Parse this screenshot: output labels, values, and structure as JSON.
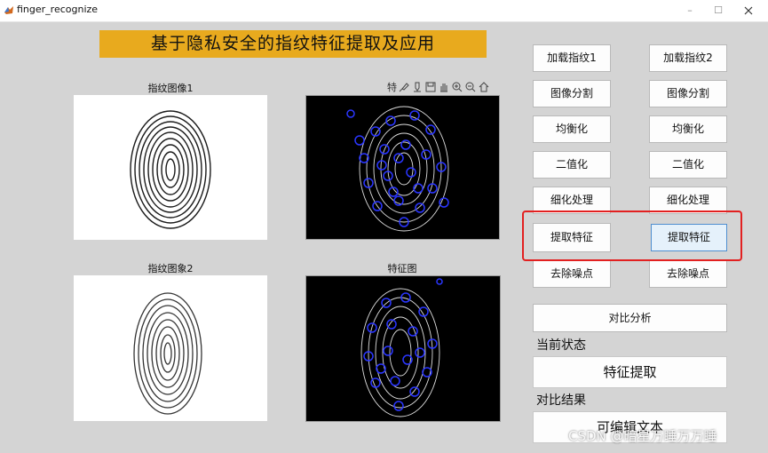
{
  "window": {
    "title": "finger_recognize",
    "minimize": "–",
    "maximize": "☐"
  },
  "banner": {
    "title": "基于隐私安全的指纹特征提取及应用"
  },
  "axes": {
    "img1_title": "指纹图像1",
    "img2_title": "指纹图象2",
    "feat2_title": "特征图",
    "toolbar_label": "特"
  },
  "buttons": {
    "left": [
      "加载指纹1",
      "图像分割",
      "均衡化",
      "二值化",
      "细化处理",
      "提取特征",
      "去除噪点"
    ],
    "right": [
      "加载指纹2",
      "图像分割",
      "均衡化",
      "二值化",
      "细化处理",
      "提取特征",
      "去除噪点"
    ],
    "compare": "对比分析"
  },
  "status": {
    "label": "当前状态",
    "value": "特征提取"
  },
  "result": {
    "label": "对比结果",
    "value": "可编辑文本"
  },
  "watermark": "CSDN @暗星万睡万万睡",
  "colors": {
    "banner": "#e8aa1e",
    "highlight": "#e22020",
    "feature_point": "#2a36ff"
  }
}
